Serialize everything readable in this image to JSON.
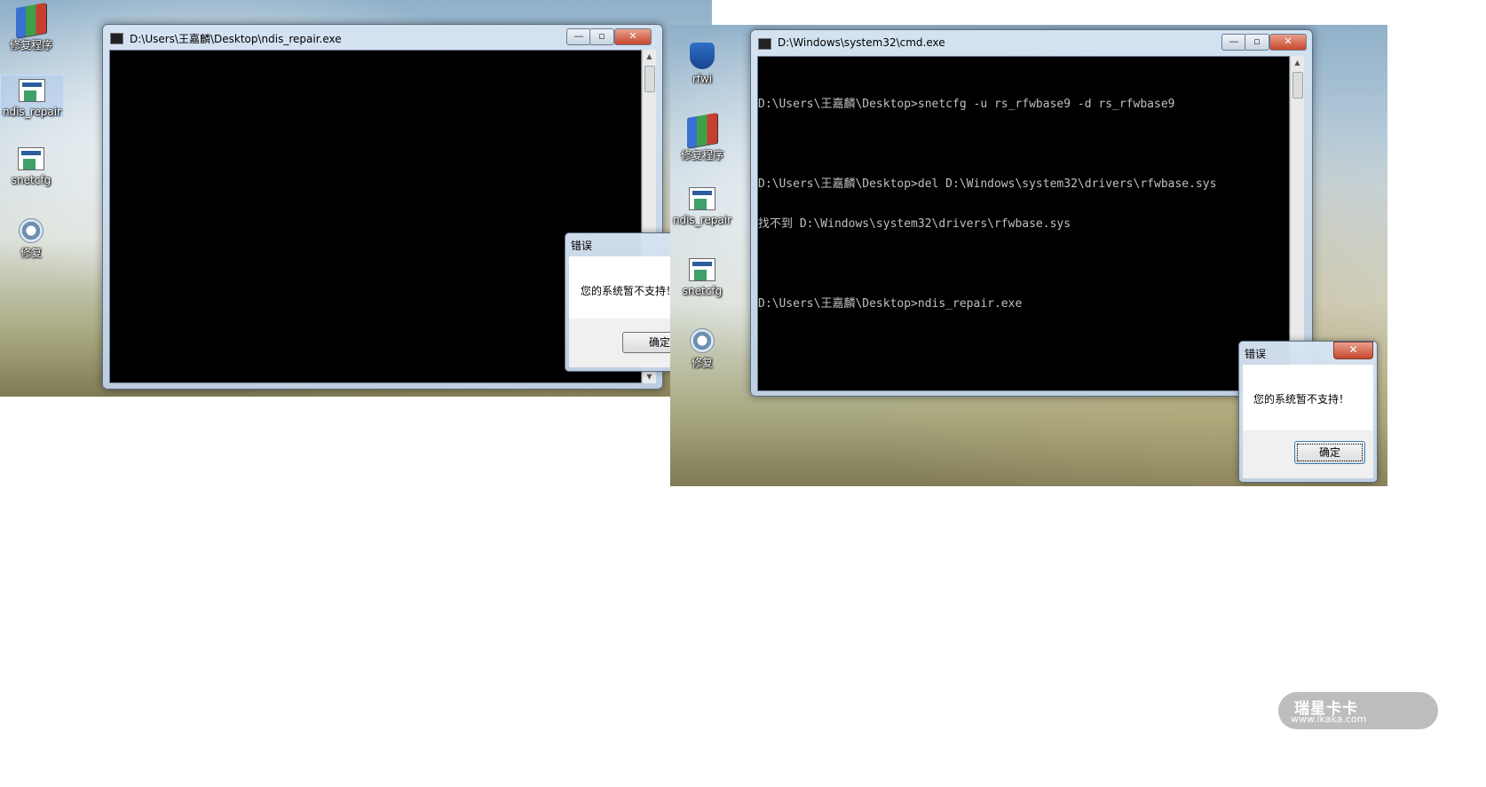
{
  "left_screen": {
    "desktop_icons": [
      {
        "label": "修复程序",
        "icon": "winrar-archive-icon"
      },
      {
        "label": "ndis_repair",
        "icon": "exe-app-icon"
      },
      {
        "label": "snetcfg",
        "icon": "exe-app-icon"
      },
      {
        "label": "修复",
        "icon": "settings-gear-icon"
      }
    ],
    "console_window": {
      "title": "D:\\Users\\王嘉麟\\Desktop\\ndis_repair.exe",
      "minimize": "—",
      "maximize": "▫",
      "close": "✕"
    },
    "error_dialog": {
      "title": "错误",
      "message": "您的系统暂不支持！",
      "ok_label": "确定"
    }
  },
  "right_screen": {
    "desktop_icons": [
      {
        "label": "rfwi",
        "icon": "shield-icon"
      },
      {
        "label": "修复程序",
        "icon": "winrar-archive-icon"
      },
      {
        "label": "ndis_repair",
        "icon": "exe-app-icon"
      },
      {
        "label": "snetcfg",
        "icon": "exe-app-icon"
      },
      {
        "label": "修复",
        "icon": "settings-gear-icon"
      }
    ],
    "cmd_window": {
      "title": "D:\\Windows\\system32\\cmd.exe",
      "minimize": "—",
      "maximize": "▫",
      "close": "✕",
      "lines": [
        "D:\\Users\\王嘉麟\\Desktop>snetcfg -u rs_rfwbase9 -d rs_rfwbase9",
        "",
        "D:\\Users\\王嘉麟\\Desktop>del D:\\Windows\\system32\\drivers\\rfwbase.sys",
        "找不到 D:\\Windows\\system32\\drivers\\rfwbase.sys",
        "",
        "D:\\Users\\王嘉麟\\Desktop>ndis_repair.exe"
      ]
    },
    "error_dialog": {
      "title": "错误",
      "close": "✕",
      "message": "您的系统暂不支持！",
      "ok_label": "确定"
    }
  },
  "watermark": {
    "brand": "瑞星卡卡",
    "url": "www.ikaka.com"
  }
}
